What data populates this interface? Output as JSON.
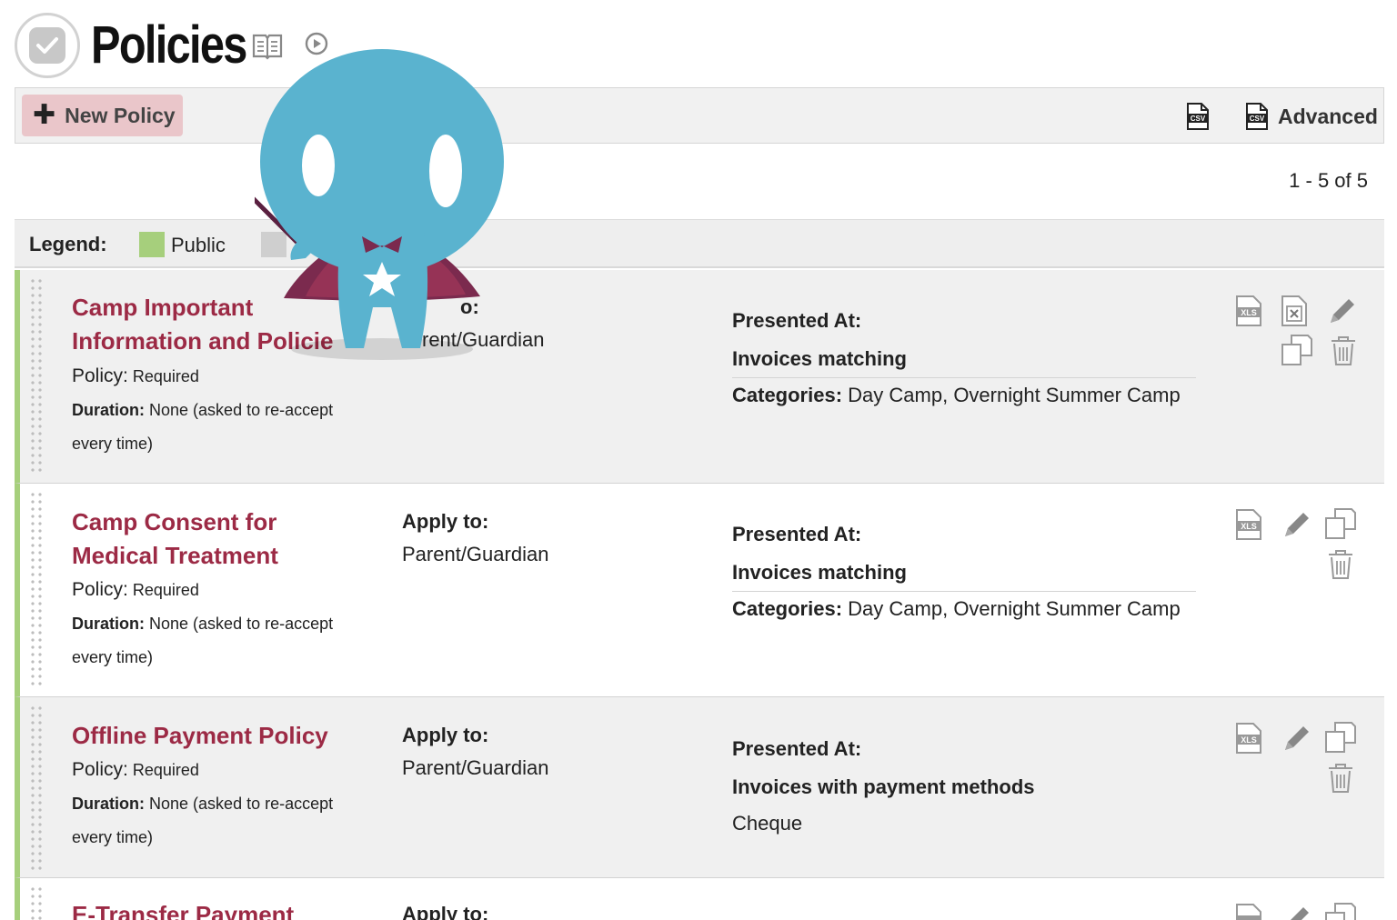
{
  "page": {
    "title": "Policies"
  },
  "toolbar": {
    "new_label": "New Policy",
    "advanced_label": "Advanced"
  },
  "pager": {
    "text": "1 - 5 of 5"
  },
  "legend": {
    "label": "Legend:",
    "public_label": "Public",
    "public_color": "#a6cf7c",
    "internal_color": "#cfcfcf"
  },
  "rows": [
    {
      "title_line1": "Camp Important",
      "title_line2": "Information and Policie",
      "policy_key": "Policy:",
      "policy_value": "Required",
      "duration_key": "Duration:",
      "duration_value": "None (asked to re-accept",
      "duration_cont": "every time)",
      "apply_heading": "o:",
      "apply_value": "rent/Guardian",
      "presented_heading": "Presented At:",
      "presented_sub": "Invoices matching",
      "categories_key": "Categories:",
      "categories_value": "Day Camp, Overnight Summer Camp"
    },
    {
      "title_line1": "Camp Consent for",
      "title_line2": "Medical Treatment",
      "policy_key": "Policy:",
      "policy_value": "Required",
      "duration_key": "Duration:",
      "duration_value": "None (asked to re-accept",
      "duration_cont": "every time)",
      "apply_heading": "Apply to:",
      "apply_value": "Parent/Guardian",
      "presented_heading": "Presented At:",
      "presented_sub": "Invoices matching",
      "categories_key": "Categories:",
      "categories_value": "Day Camp, Overnight Summer Camp"
    },
    {
      "title_line1": "Offline Payment Policy",
      "policy_key": "Policy:",
      "policy_value": "Required",
      "duration_key": "Duration:",
      "duration_value": "None (asked to re-accept",
      "duration_cont": "every time)",
      "apply_heading": "Apply to:",
      "apply_value": "Parent/Guardian",
      "presented_heading": "Presented At:",
      "presented_sub": "Invoices with payment methods",
      "payment_method": "Cheque"
    },
    {
      "title_line1": "E-Transfer Payment",
      "apply_heading": "Apply to:"
    }
  ],
  "icons": {
    "checkbox": "check-icon",
    "help": "book-icon",
    "tour": "tour-icon",
    "csv": "csv-icon",
    "xls": "xls-icon",
    "edit": "pencil-icon",
    "copy": "copy-icon",
    "delete": "trash-icon",
    "remove": "x-file-icon",
    "add": "plus-icon"
  },
  "colors": {
    "accent": "#9c2a45",
    "new_button_bg": "#eac6ca",
    "mascot": "#5ab3cf",
    "cape": "#6b2346"
  }
}
